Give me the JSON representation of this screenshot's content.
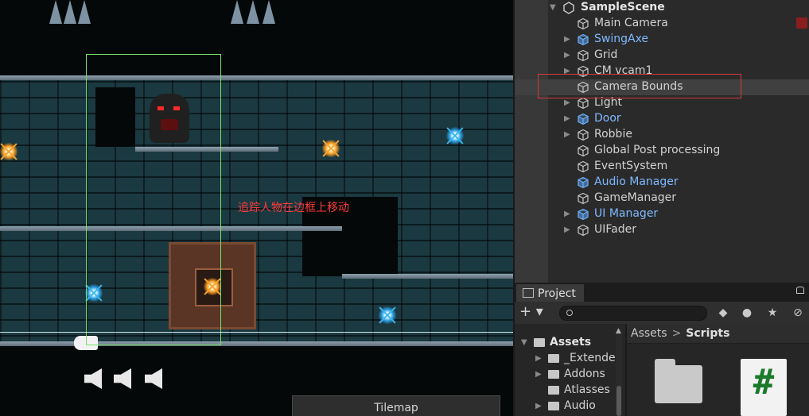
{
  "scene_view": {
    "annotation": "追踪人物在边框上移动",
    "tilemap_tab": "Tilemap",
    "colors": {
      "camera_frame": "#79e06a",
      "annotation": "#ff3b3b"
    }
  },
  "hierarchy": {
    "scene_name": "SampleScene",
    "items": [
      {
        "label": "Main Camera",
        "expandable": false,
        "prefab": false
      },
      {
        "label": "SwingAxe",
        "expandable": true,
        "prefab": true
      },
      {
        "label": "Grid",
        "expandable": true,
        "prefab": false
      },
      {
        "label": "CM vcam1",
        "expandable": true,
        "prefab": false
      },
      {
        "label": "Camera Bounds",
        "expandable": false,
        "prefab": false,
        "selected": true
      },
      {
        "label": "Light",
        "expandable": true,
        "prefab": false
      },
      {
        "label": "Door",
        "expandable": true,
        "prefab": true
      },
      {
        "label": "Robbie",
        "expandable": true,
        "prefab": false
      },
      {
        "label": "Global Post processing",
        "expandable": false,
        "prefab": false
      },
      {
        "label": "EventSystem",
        "expandable": false,
        "prefab": false
      },
      {
        "label": "Audio Manager",
        "expandable": false,
        "prefab": true
      },
      {
        "label": "GameManager",
        "expandable": false,
        "prefab": false
      },
      {
        "label": "UI Manager",
        "expandable": true,
        "prefab": true
      },
      {
        "label": "UIFader",
        "expandable": true,
        "prefab": false
      }
    ],
    "colors": {
      "prefab_text": "#7fb9ff",
      "highlight_box": "#d63a3a"
    }
  },
  "project": {
    "tab_label": "Project",
    "toolbar": {
      "add_label": "+ ▾"
    },
    "tree": [
      {
        "label": "Assets",
        "expanded": true,
        "depth": 0
      },
      {
        "label": "_Extende",
        "expanded": false,
        "depth": 1
      },
      {
        "label": "Addons",
        "expanded": false,
        "depth": 1
      },
      {
        "label": "Atlasses",
        "expanded": false,
        "depth": 1
      },
      {
        "label": "Audio",
        "expanded": false,
        "depth": 1
      }
    ],
    "breadcrumb": {
      "root": "Assets",
      "separator": ">",
      "current": "Scripts"
    },
    "script_icon_glyph": "#"
  }
}
